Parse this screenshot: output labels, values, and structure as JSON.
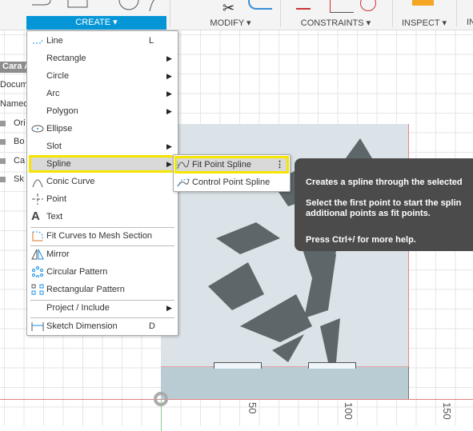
{
  "toolbar": {
    "groups": [
      {
        "label": "CREATE ▾"
      },
      {
        "label": "MODIFY ▾"
      },
      {
        "label": "CONSTRAINTS ▾"
      },
      {
        "label": "INSPECT ▾"
      },
      {
        "label": "IN"
      }
    ],
    "accent": "#0696d7"
  },
  "browser": {
    "header": "Cara A",
    "rows": [
      "Docume",
      "Named V",
      "Ori",
      "Bo",
      "Ca",
      "Sk"
    ]
  },
  "menu": {
    "items": [
      {
        "label": "Line",
        "shortcut": "L"
      },
      {
        "label": "Rectangle"
      },
      {
        "label": "Circle"
      },
      {
        "label": "Arc"
      },
      {
        "label": "Polygon"
      },
      {
        "label": "Ellipse"
      },
      {
        "label": "Slot"
      },
      {
        "label": "Spline"
      },
      {
        "label": "Conic Curve"
      },
      {
        "label": "Point"
      },
      {
        "label": "Text"
      },
      {
        "label": "Fit Curves to Mesh Section"
      },
      {
        "label": "Mirror"
      },
      {
        "label": "Circular Pattern"
      },
      {
        "label": "Rectangular Pattern"
      },
      {
        "label": "Project / Include"
      },
      {
        "label": "Sketch Dimension",
        "shortcut": "D"
      }
    ]
  },
  "submenu": {
    "items": [
      {
        "label": "Fit Point Spline"
      },
      {
        "label": "Control Point Spline"
      }
    ]
  },
  "tooltip": {
    "line1": "Creates a spline through the selected",
    "line2": "Select the first point to start the splin",
    "line3": "additional points as fit points.",
    "line4": "Press Ctrl+/ for more help."
  },
  "axis": {
    "ticks": [
      "50",
      "100",
      "150"
    ]
  },
  "highlight_color": "#f5e500"
}
